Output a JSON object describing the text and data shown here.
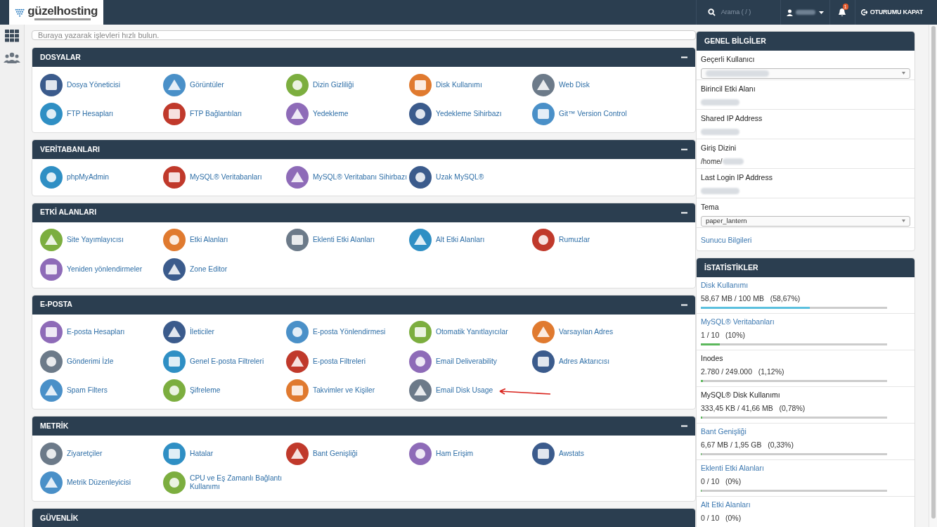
{
  "topbar": {
    "logo": "güzelhosting",
    "search": {
      "placeholder": "Arama ( / )"
    },
    "notifications": {
      "badge": "1"
    },
    "logout": "OTURUMU KAPAT"
  },
  "quick_find": {
    "placeholder": "Buraya yazarak işlevleri hızlı bulun."
  },
  "sections": [
    {
      "title": "DOSYALAR",
      "expanded": true,
      "items": [
        {
          "label": "Dosya Yöneticisi"
        },
        {
          "label": "Görüntüler"
        },
        {
          "label": "Dizin Gizliliği"
        },
        {
          "label": "Disk Kullanımı"
        },
        {
          "label": "Web Disk"
        },
        {
          "label": "FTP Hesapları"
        },
        {
          "label": "FTP Bağlantıları"
        },
        {
          "label": "Yedekleme"
        },
        {
          "label": "Yedekleme Sihirbazı"
        },
        {
          "label": "Git™ Version Control"
        }
      ]
    },
    {
      "title": "VERİTABANLARI",
      "expanded": true,
      "items": [
        {
          "label": "phpMyAdmin"
        },
        {
          "label": "MySQL® Veritabanları"
        },
        {
          "label": "MySQL® Veritabanı Sihirbazı"
        },
        {
          "label": "Uzak MySQL®"
        }
      ]
    },
    {
      "title": "ETKİ ALANLARI",
      "expanded": true,
      "items": [
        {
          "label": "Site Yayımlayıcısı"
        },
        {
          "label": "Etki Alanları"
        },
        {
          "label": "Eklenti Etki Alanları"
        },
        {
          "label": "Alt Etki Alanları"
        },
        {
          "label": "Rumuzlar"
        },
        {
          "label": "Yeniden yönlendirmeler"
        },
        {
          "label": "Zone Editor"
        }
      ]
    },
    {
      "title": "E-POSTA",
      "expanded": true,
      "items": [
        {
          "label": "E-posta Hesapları"
        },
        {
          "label": "İleticiler"
        },
        {
          "label": "E-posta Yönlendirmesi"
        },
        {
          "label": "Otomatik Yanıtlayıcılar"
        },
        {
          "label": "Varsayılan Adres"
        },
        {
          "label": "Gönderimi İzle"
        },
        {
          "label": "Genel E-posta Filtreleri"
        },
        {
          "label": "E-posta Filtreleri"
        },
        {
          "label": "Email Deliverability"
        },
        {
          "label": "Adres Aktarıcısı"
        },
        {
          "label": "Spam Filters"
        },
        {
          "label": "Şifreleme"
        },
        {
          "label": "Takvimler ve Kişiler"
        },
        {
          "label": "Email Disk Usage",
          "highlighted": true
        }
      ]
    },
    {
      "title": "METRİK",
      "expanded": true,
      "items": [
        {
          "label": "Ziyaretçiler"
        },
        {
          "label": "Hatalar"
        },
        {
          "label": "Bant Genişliği"
        },
        {
          "label": "Ham Erişim"
        },
        {
          "label": "Awstats"
        },
        {
          "label": "Metrik Düzenleyicisi"
        },
        {
          "label": "CPU ve Eş Zamanlı Bağlantı Kullanımı"
        }
      ]
    },
    {
      "title": "GÜVENLİK"
    }
  ],
  "general_info": {
    "title": "GENEL BİLGİLER",
    "fields": [
      {
        "label": "Geçerli Kullanıcı",
        "kind": "select"
      },
      {
        "label": "Birincil Etki Alanı",
        "kind": "hidden"
      },
      {
        "label": "Shared IP Address",
        "kind": "hidden"
      },
      {
        "label": "Giriş Dizini",
        "kind": "hidden",
        "value": "/home/"
      },
      {
        "label": "Last Login IP Address",
        "kind": "hidden"
      },
      {
        "label": "Tema",
        "kind": "select",
        "value": "paper_lantern"
      }
    ],
    "link": "Sunucu Bilgileri"
  },
  "statistics": {
    "title": "İSTATİSTİKLER",
    "items": [
      {
        "label": "Disk Kullanımı",
        "link": true,
        "value": "58,67 MB / 100 MB   (58,67%)",
        "level": 0.5867,
        "color": "#5bc0de"
      },
      {
        "label": "MySQL® Veritabanları",
        "link": true,
        "value": "1 / 10   (10%)",
        "level": 0.1,
        "color": "#5cb85c"
      },
      {
        "label": "Inodes",
        "link": false,
        "value": "2.780 / 249.000   (1,12%)",
        "level": 0.0112,
        "color": "#5cb85c"
      },
      {
        "label": "MySQL® Disk Kullanımı",
        "link": false,
        "value": "333,45 KB / 41,66 MB   (0,78%)",
        "level": 0.0078,
        "color": "#5cb85c"
      },
      {
        "label": "Bant Genişliği",
        "link": true,
        "value": "6,67 MB / 1,95 GB   (0,33%)",
        "level": 0.0033,
        "color": "#5cb85c"
      },
      {
        "label": "Eklenti Etki Alanları",
        "link": true,
        "value": "0 / 10   (0%)",
        "level": 0,
        "color": "#5cb85c"
      },
      {
        "label": "Alt Etki Alanları",
        "link": true,
        "value": "0 / 10   (0%)"
      }
    ]
  }
}
